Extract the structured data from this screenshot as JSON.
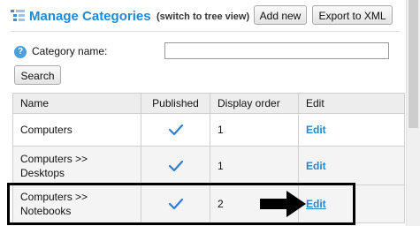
{
  "header": {
    "title": "Manage Categories",
    "subtitle": "(switch to tree view)",
    "add_new_label": "Add new",
    "export_label": "Export to XML"
  },
  "search": {
    "field_label": "Category name:",
    "value": "",
    "button_label": "Search"
  },
  "table": {
    "columns": [
      "Name",
      "Published",
      "Display order",
      "Edit"
    ],
    "rows": [
      {
        "name_line1": "Computers",
        "name_line2": "",
        "published": true,
        "display_order": "1",
        "edit": "Edit"
      },
      {
        "name_line1": "Computers >>",
        "name_line2": "Desktops",
        "published": true,
        "display_order": "1",
        "edit": "Edit"
      },
      {
        "name_line1": "Computers >>",
        "name_line2": "Notebooks",
        "published": true,
        "display_order": "2",
        "edit": "Edit"
      }
    ]
  },
  "icons": {
    "category": "category-list-icon",
    "help": "help-icon",
    "published": "checkmark-icon",
    "pointer": "arrow-right-icon"
  },
  "colors": {
    "accent": "#1e8ad6",
    "check": "#2f7fd1",
    "highlight": "#000000"
  }
}
